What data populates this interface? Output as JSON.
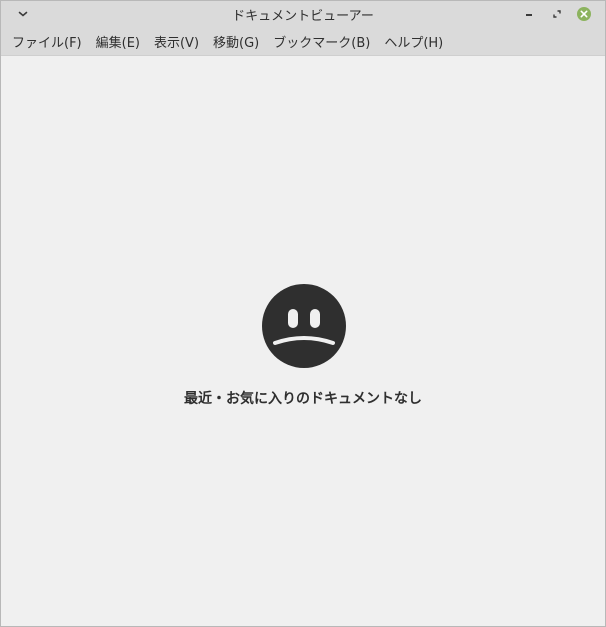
{
  "window": {
    "title": "ドキュメントビューアー",
    "accent_close": "#8cb35e"
  },
  "icons": {
    "window_menu": "chevron-down-icon",
    "minimize": "minimize-icon",
    "maximize": "maximize-icon",
    "close": "close-icon",
    "empty_state": "sad-face-icon"
  },
  "menu": {
    "items": [
      {
        "label": "ファイル(F)"
      },
      {
        "label": "編集(E)"
      },
      {
        "label": "表示(V)"
      },
      {
        "label": "移動(G)"
      },
      {
        "label": "ブックマーク(B)"
      },
      {
        "label": "ヘルプ(H)"
      }
    ]
  },
  "empty_state": {
    "message": "最近・お気に入りのドキュメントなし"
  }
}
